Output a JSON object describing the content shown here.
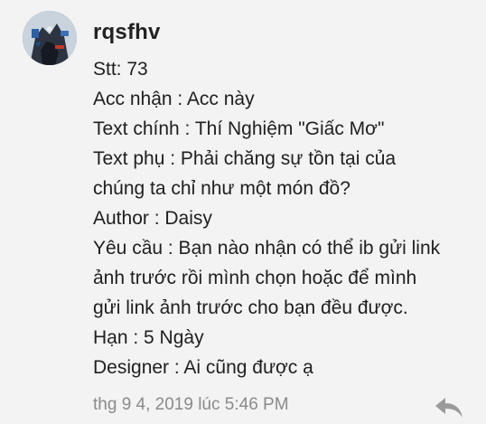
{
  "comment": {
    "username": "rqsfhv",
    "lines": [
      "Stt: 73",
      "Acc nhận : Acc này",
      "Text chính : Thí Nghiệm \"Giấc Mơ\"",
      "Text phụ : Phải chăng sự tồn tại của",
      "chúng ta chỉ như một món đồ?",
      "Author : Daisy",
      "Yêu cầu : Bạn nào nhận có thể ib gửi link",
      "ảnh trước rồi mình chọn hoặc để mình",
      "gửi link ảnh trước cho bạn đều được.",
      "Hạn : 5 Ngày",
      "Designer : Ai cũng được ạ"
    ],
    "timestamp": "thg 9 4, 2019 lúc 5:46 PM",
    "reply_icon": "reply-icon"
  }
}
